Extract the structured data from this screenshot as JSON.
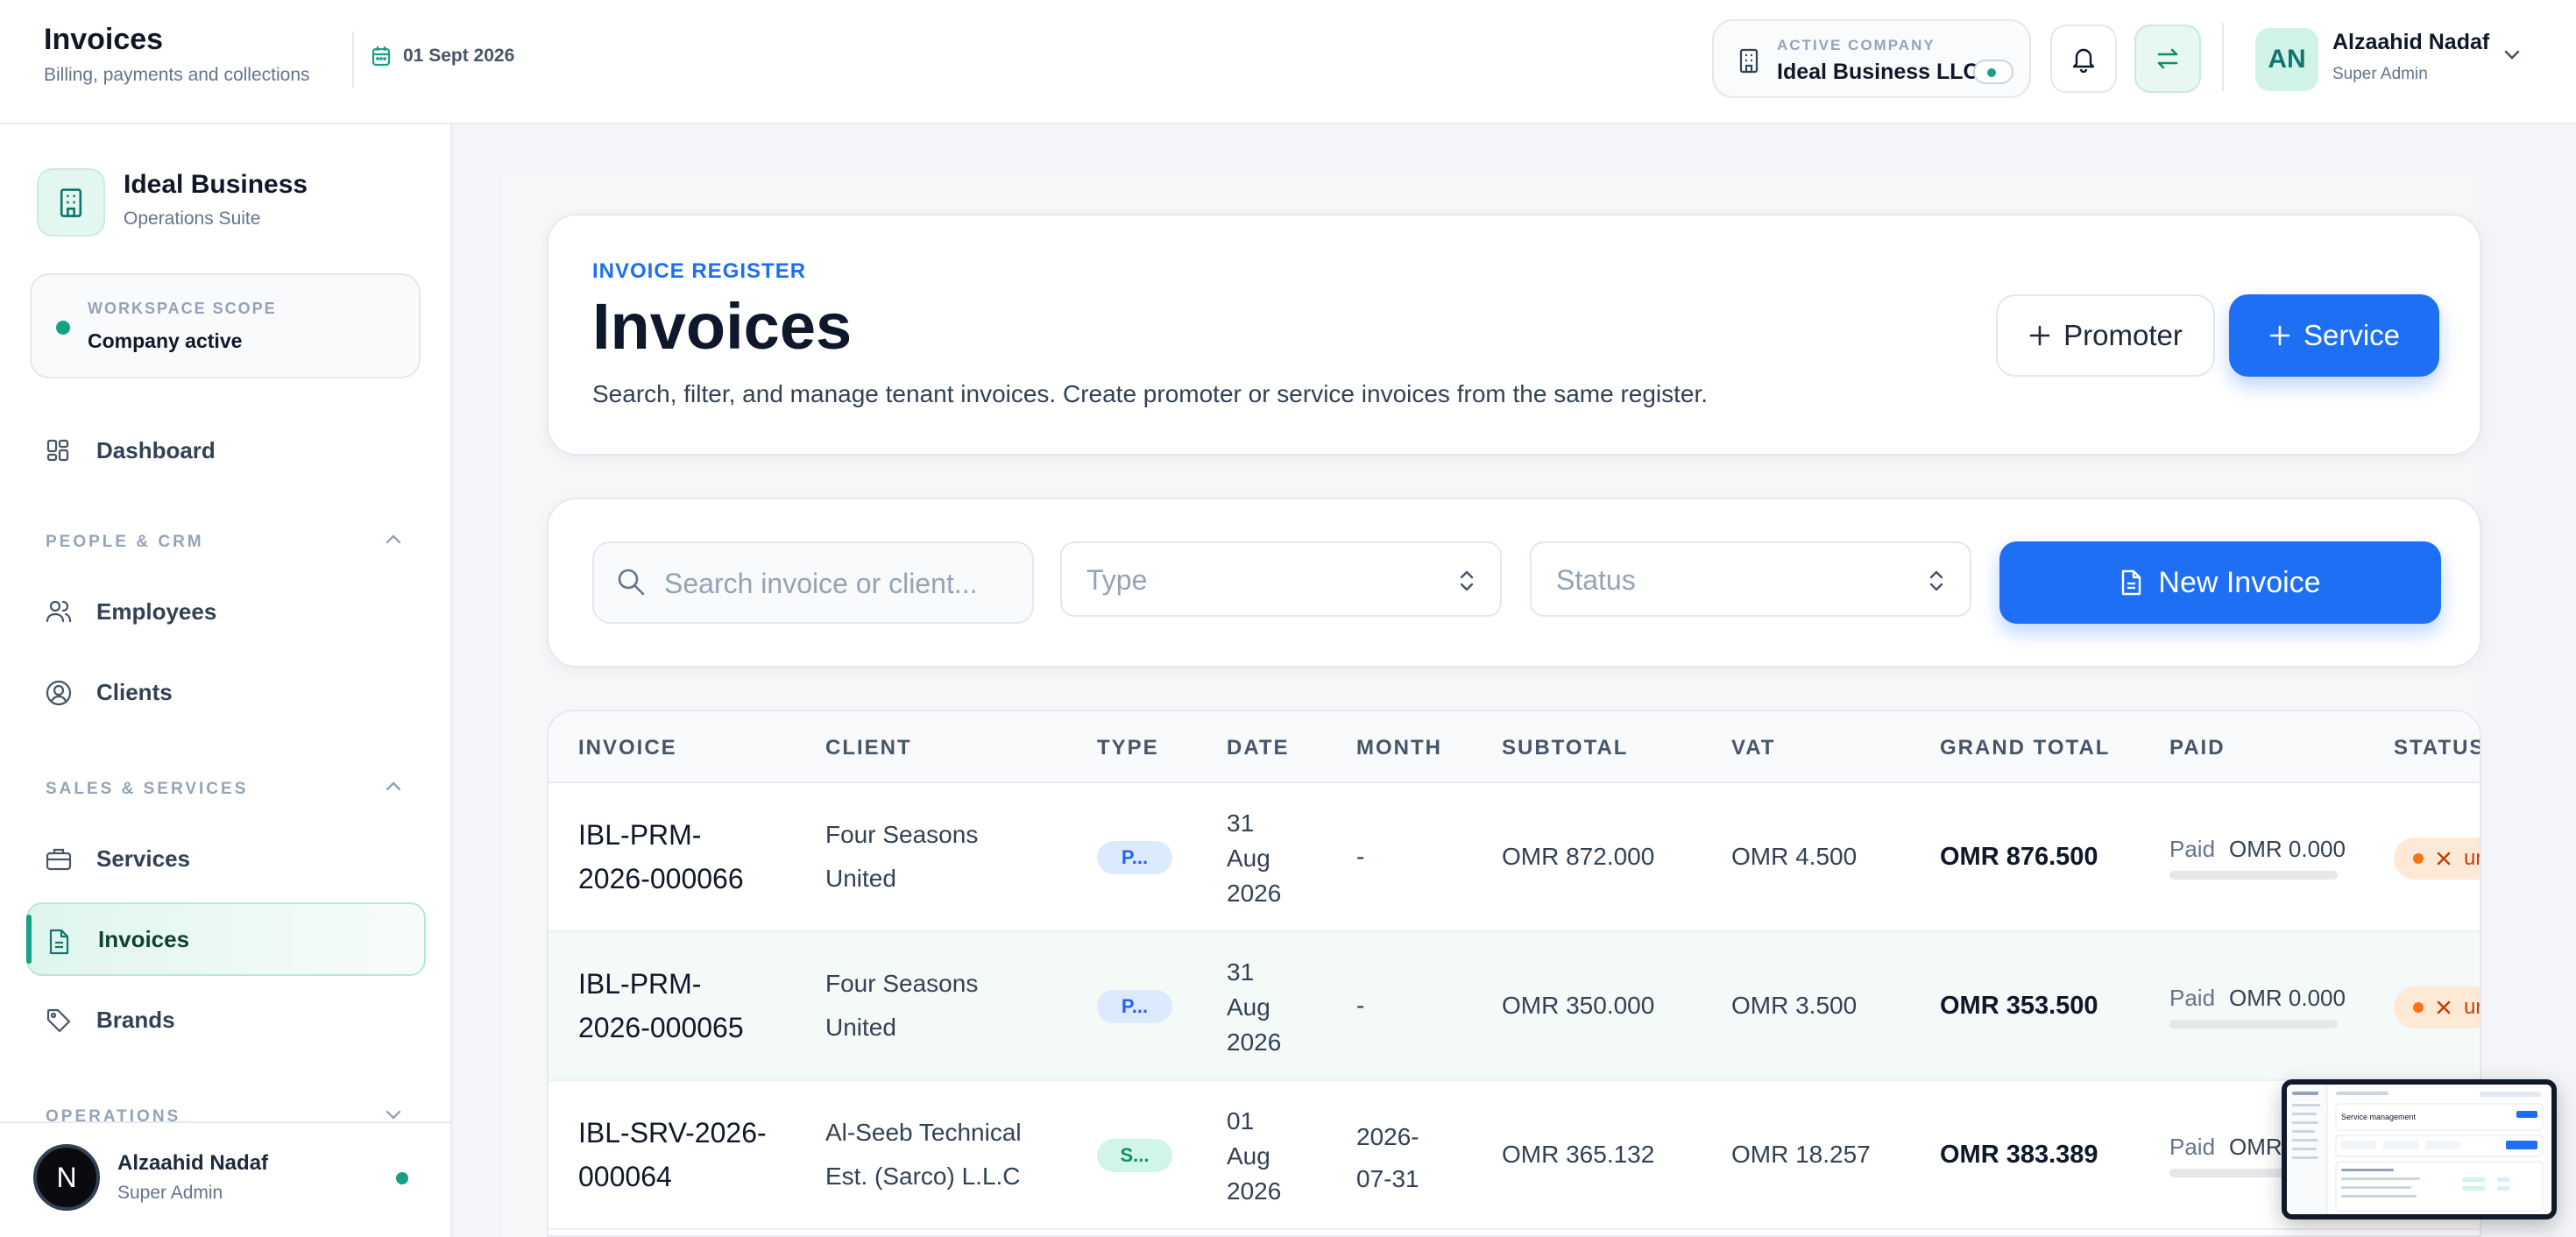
{
  "topbar": {
    "title": "Invoices",
    "subtitle": "Billing, payments and collections",
    "date": "01 Sept 2026",
    "active_company_label": "ACTIVE COMPANY",
    "active_company": "Ideal Business LLC",
    "user_initials": "AN",
    "user_name": "Alzaahid Nadaf",
    "user_role": "Super Admin"
  },
  "sidebar": {
    "brand_name": "Ideal Business",
    "brand_sub": "Operations Suite",
    "scope_label": "WORKSPACE SCOPE",
    "scope_value": "Company active",
    "dashboard": "Dashboard",
    "sections": {
      "people": "PEOPLE & CRM",
      "sales": "SALES & SERVICES",
      "operations": "OPERATIONS"
    },
    "items": {
      "employees": "Employees",
      "clients": "Clients",
      "services": "Services",
      "invoices": "Invoices",
      "brands": "Brands"
    },
    "user_initial": "N",
    "user_name": "Alzaahid Nadaf",
    "user_role": "Super Admin"
  },
  "hero": {
    "eyebrow": "INVOICE REGISTER",
    "title": "Invoices",
    "description": "Search, filter, and manage tenant invoices. Create promoter or service invoices from the same register.",
    "promoter_label": "Promoter",
    "service_label": "Service"
  },
  "filters": {
    "search_placeholder": "Search invoice or client...",
    "type_placeholder": "Type",
    "status_placeholder": "Status",
    "new_invoice_label": "New Invoice"
  },
  "table": {
    "headers": [
      "INVOICE",
      "CLIENT",
      "TYPE",
      "DATE",
      "MONTH",
      "SUBTOTAL",
      "VAT",
      "GRAND TOTAL",
      "PAID",
      "STATUS"
    ],
    "rows": [
      {
        "invoice_l1": "IBL-PRM-",
        "invoice_l2": "2026-000066",
        "client_l1": "Four Seasons",
        "client_l2": "United",
        "type": "P...",
        "date_l1": "31",
        "date_l2": "Aug",
        "date_l3": "2026",
        "month_l1": "-",
        "month_l2": "",
        "subtotal": "OMR 872.000",
        "vat": "OMR 4.500",
        "grand_total": "OMR 876.500",
        "paid_label": "Paid",
        "paid_amount": "OMR 0.000",
        "paid_fraction": 0,
        "status": "ur"
      },
      {
        "invoice_l1": "IBL-PRM-",
        "invoice_l2": "2026-000065",
        "client_l1": "Four Seasons",
        "client_l2": "United",
        "type": "P...",
        "date_l1": "31",
        "date_l2": "Aug",
        "date_l3": "2026",
        "month_l1": "-",
        "month_l2": "",
        "subtotal": "OMR 350.000",
        "vat": "OMR 3.500",
        "grand_total": "OMR 353.500",
        "paid_label": "Paid",
        "paid_amount": "OMR 0.000",
        "paid_fraction": 0,
        "status": "ur"
      },
      {
        "invoice_l1": "IBL-SRV-2026-",
        "invoice_l2": "000064",
        "client_l1": "Al-Seeb Technical",
        "client_l2": "Est. (Sarco) L.L.C",
        "type": "S...",
        "date_l1": "01",
        "date_l2": "Aug",
        "date_l3": "2026",
        "month_l1": "2026-",
        "month_l2": "07-31",
        "subtotal": "OMR 365.132",
        "vat": "OMR 18.257",
        "grand_total": "OMR 383.389",
        "paid_label": "Paid",
        "paid_amount": "OMR",
        "paid_fraction": 0,
        "status": ""
      }
    ]
  },
  "thumbnail": {
    "title": "Service management"
  },
  "colors": {
    "primary": "#1f6ff5",
    "accent_green": "#16a085",
    "status_unpaid_bg": "#fde9d6",
    "status_unpaid_fg": "#c2410c"
  }
}
